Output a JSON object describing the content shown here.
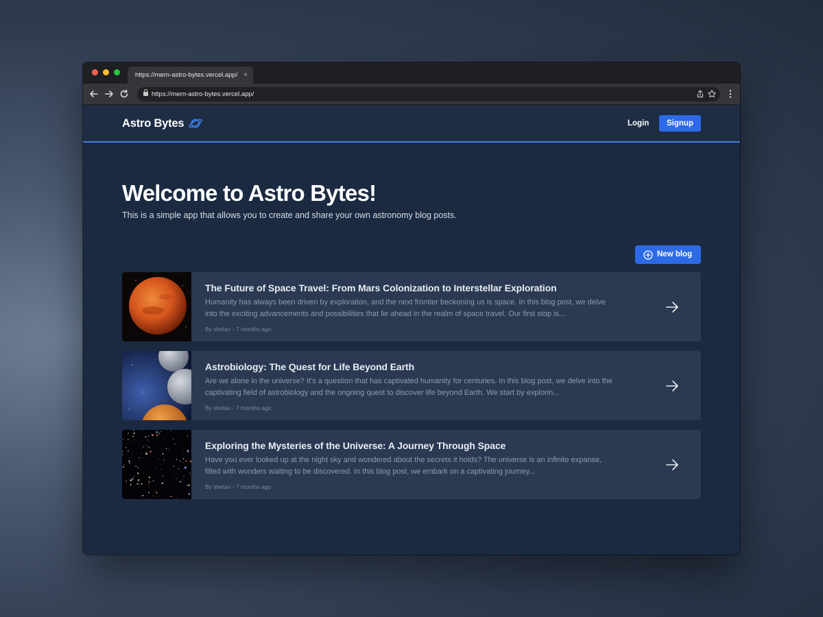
{
  "browser": {
    "tab_title": "https://mern-astro-bytes.vercel.app/",
    "tab_close": "×",
    "url": "https://mern-astro-bytes.vercel.app/",
    "colors": {
      "red": "#ff5f57",
      "yellow": "#febc2e",
      "green": "#28c840"
    }
  },
  "header": {
    "brand": "Astro Bytes",
    "brand_icon": "planet-icon",
    "login_label": "Login",
    "signup_label": "Signup",
    "accent": "#2d6ae6"
  },
  "hero": {
    "title": "Welcome to Astro Bytes!",
    "subtitle": "This is a simple app that allows you to create and share your own astronomy blog posts."
  },
  "actions": {
    "new_blog_label": "New blog",
    "new_blog_icon": "plus-circle-icon"
  },
  "blogs": [
    {
      "title": "The Future of Space Travel: From Mars Colonization to Interstellar Exploration",
      "excerpt": "Humanity has always been driven by exploration, and the next frontier beckoning us is space. In this blog post, we delve into the exciting advancements and possibilities that lie ahead in the realm of space travel. Our first stop is...",
      "meta": "By sbetav - 7 months ago",
      "thumb": "mars"
    },
    {
      "title": "Astrobiology: The Quest for Life Beyond Earth",
      "excerpt": "Are we alone in the universe? It's a question that has captivated humanity for centuries. In this blog post, we delve into the captivating field of astrobiology and the ongoing quest to discover life beyond Earth. We start by explorin...",
      "meta": "By sbetav - 7 months ago",
      "thumb": "planets"
    },
    {
      "title": "Exploring the Mysteries of the Universe: A Journey Through Space",
      "excerpt": "Have you ever looked up at the night sky and wondered about the secrets it holds? The universe is an infinite expanse, filled with wonders waiting to be discovered. In this blog post, we embark on a captivating journey...",
      "meta": "By sbetav - 7 months ago",
      "thumb": "deep-field"
    }
  ]
}
